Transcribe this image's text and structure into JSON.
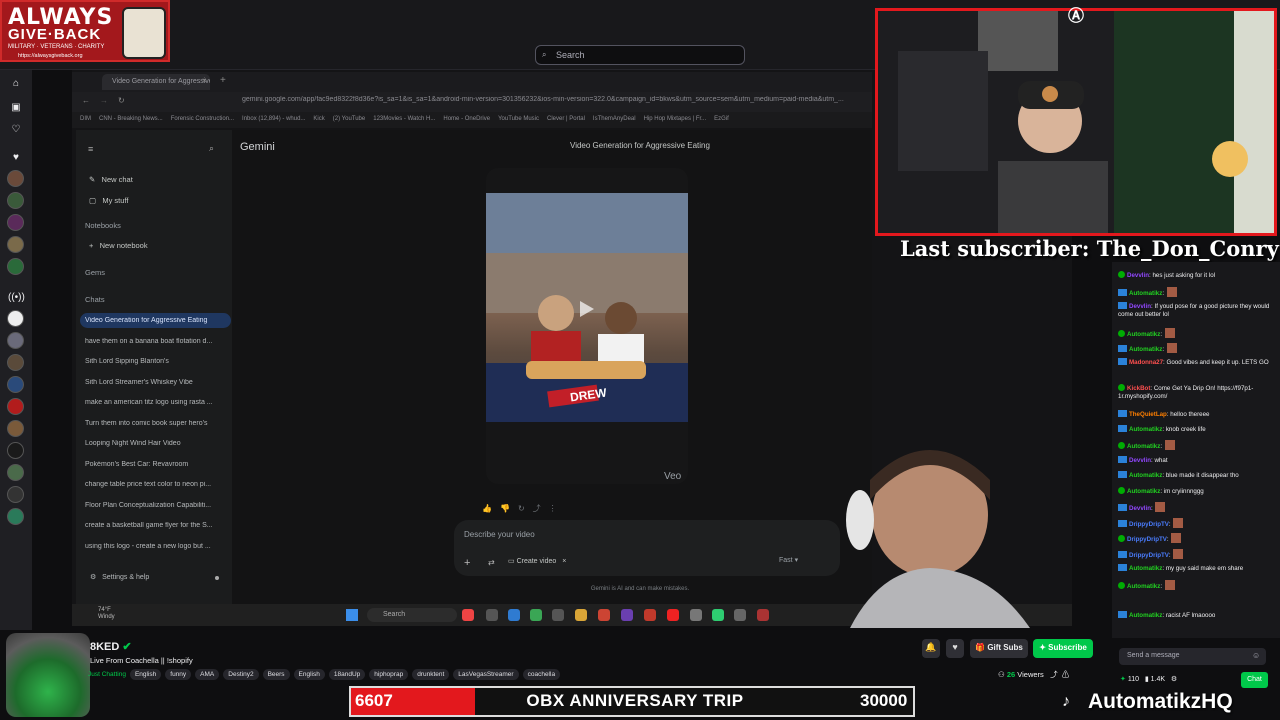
{
  "brand": {
    "line1": "ALWAYS",
    "line2": "GIVE·BACK",
    "tagline": "MILITARY · VETERANS · CHARITY",
    "url": "https://alwaysgiveback.org"
  },
  "twitch_header": {
    "search_placeholder": "Search"
  },
  "browser": {
    "tab_title": "Video Generation for Aggressive Eating",
    "url": "gemini.google.com/app/fac9ed8322f8d36e?is_sa=1&is_sa=1&android-min-version=301356232&ios-min-version=322.0&campaign_id=bkws&utm_source=sem&utm_medium=paid-media&utm_...",
    "bookmarks": [
      "DIM",
      "CNN - Breaking News...",
      "Forensic Construction...",
      "Inbox (12,894) - whud...",
      "Kick",
      "(2) YouTube",
      "123Movies - Watch H...",
      "Home - OneDrive",
      "YouTube Music",
      "Clever | Portal",
      "IsThemAnyDeal",
      "Hip Hop Mixtapes | Fr...",
      "EzGif"
    ]
  },
  "gemini": {
    "brand": "Gemini",
    "conversation_title": "Video Generation for Aggressive Eating",
    "nav": {
      "new_chat": "New chat",
      "my_stuff": "My stuff",
      "notebooks": "Notebooks",
      "new_notebook": "New notebook",
      "gems": "Gems",
      "chats": "Chats",
      "settings": "Settings & help"
    },
    "chats": [
      "Video Generation for Aggressive Eating",
      "have them on a banana boat flotation d...",
      "Sith Lord Sipping Blanton's",
      "Sith Lord Streamer's Whiskey Vibe",
      "make an american titz logo using rasta ...",
      "Turn them into comic book super hero's",
      "Looping Night Wind Hair Video",
      "Pokémon's Best Car: Revavroom",
      "change table price text color to neon pi...",
      "Floor Plan Conceptualization Capabiliti...",
      "create a basketball game flyer for the S...",
      "using this logo - create a new logo but ..."
    ],
    "video_caption": "DREW",
    "veo_label": "Veo",
    "prompt_placeholder": "Describe your video",
    "create_chip": "Create video",
    "mode": "Fast",
    "disclaimer": "Gemini is AI and can make mistakes."
  },
  "taskbar": {
    "temp": "74°F",
    "weather": "Windy",
    "search": "Search"
  },
  "overlay": {
    "last_subscriber": "Last subscriber: The_Don_Conry"
  },
  "chat": {
    "messages": [
      {
        "user": "Devvlin",
        "text": "hes just asking for it lol",
        "color": "#9147ff"
      },
      {
        "user": "Automatikz",
        "text": "",
        "color": "#21d221"
      },
      {
        "user": "Devvlin",
        "text": "If youd pose for a good picture they would come out better lol",
        "color": "#9147ff"
      },
      {
        "user": "Automatikz",
        "text": "",
        "color": "#21d221"
      },
      {
        "user": "Automatikz",
        "text": "",
        "color": "#21d221"
      },
      {
        "user": "Madonna27",
        "text": "Good vibes and keep it up. LETS GO",
        "color": "#ff4f4f"
      },
      {
        "user": "KickBot",
        "text": "Come Get Ya Drip On! https://f97p1-1r.myshopify.com/",
        "color": "#ff4f4f"
      },
      {
        "user": "TheQuietLap",
        "text": "helloo thereee",
        "color": "#ff7f00"
      },
      {
        "user": "Automatikz",
        "text": "knob creek life",
        "color": "#21d221"
      },
      {
        "user": "Automatikz",
        "text": "",
        "color": "#21d221"
      },
      {
        "user": "Devvlin",
        "text": "what",
        "color": "#9147ff"
      },
      {
        "user": "Automatikz",
        "text": "blue made it disappear tho",
        "color": "#21d221"
      },
      {
        "user": "Automatikz",
        "text": "im cryiinnnggg",
        "color": "#21d221"
      },
      {
        "user": "Devvlin",
        "text": "",
        "color": "#9147ff"
      },
      {
        "user": "DrippyDripTV",
        "text": "",
        "color": "#4a7dff"
      },
      {
        "user": "DrippyDripTV",
        "text": "",
        "color": "#4a7dff"
      },
      {
        "user": "DrippyDripTV",
        "text": "",
        "color": "#4a7dff"
      },
      {
        "user": "Automatikz",
        "text": "my guy said make em share",
        "color": "#21d221"
      },
      {
        "user": "Automatikz",
        "text": "",
        "color": "#21d221"
      },
      {
        "user": "Automatikz",
        "text": "racist AF lmaoooo",
        "color": "#21d221"
      }
    ],
    "input_placeholder": "Send a message",
    "send_label": "Chat",
    "points": "110",
    "followers": "1.4K"
  },
  "channel": {
    "name": "8KED",
    "title": "Live From Coachella || !shopify",
    "category": "Just Chatting",
    "tags": [
      "English",
      "funny",
      "AMA",
      "Destiny2",
      "Beers",
      "English",
      "18andUp",
      "hiphoprap",
      "drunktent",
      "LasVegasStreamer",
      "coachella"
    ],
    "gift_label": "Gift Subs",
    "subscribe_label": "Subscribe",
    "viewers_count": "26",
    "viewers_label": "Viewers"
  },
  "goal": {
    "current": "6607",
    "label": "OBX ANNIVERSARY TRIP",
    "target": "30000",
    "fill_fraction": 0.22
  },
  "social": {
    "handle": "AutomatikzHQ"
  },
  "colors": {
    "twitch_green": "#00c84a",
    "overlay_red": "#e3181d",
    "gemini_active": "#1f3760"
  }
}
